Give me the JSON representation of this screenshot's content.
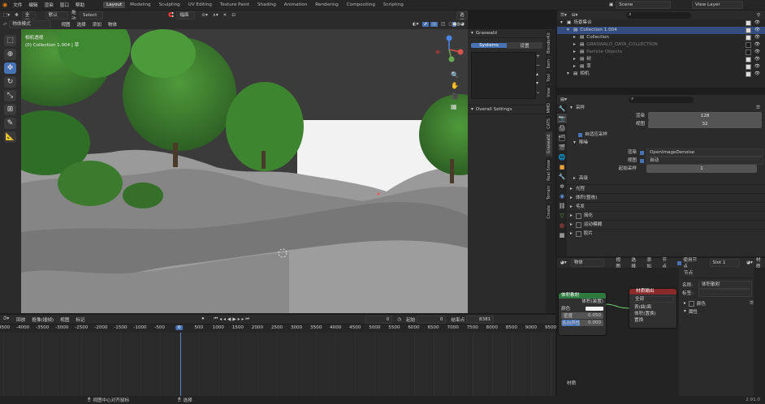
{
  "topbar": {
    "menus": [
      "文件",
      "编辑",
      "渲染",
      "窗口",
      "帮助"
    ],
    "workspaces": [
      "Layout",
      "Modeling",
      "Sculpting",
      "UV Editing",
      "Texture Paint",
      "Shading",
      "Animation",
      "Rendering",
      "Compositing",
      "Scripting"
    ],
    "active_workspace": "Layout",
    "scene": "Scene",
    "view_layer": "View Layer"
  },
  "viewport": {
    "orientation_label": "全局系",
    "pivot_label": "默认",
    "drag_label": "拖动",
    "select_mode": "Select Box",
    "snap_label": "幅面",
    "options_label": "选项",
    "mode": "物体模式",
    "menu": [
      "视图",
      "选择",
      "添加",
      "物体"
    ],
    "overlay_title": "相机透视",
    "overlay_subtitle": "(0) Collection 1.004 | 草",
    "colors": {
      "sky": "#f2f2f2",
      "ground": "#6e6e6e",
      "tree": "#3d7a2e"
    }
  },
  "npanel": {
    "title": "Graswald",
    "tab_systems": "Systems",
    "tab_settings": "设置",
    "section": "Overall Settings",
    "side_tabs": [
      "BlenderKit",
      "Item",
      "Tool",
      "View",
      "MMD",
      "CATS",
      "Graswald",
      "Real Snow",
      "Terrain",
      "Create"
    ]
  },
  "timeline": {
    "menu": [
      "回放",
      "抠像(插帧)",
      "视图",
      "标记"
    ],
    "current_frame": "0",
    "start_label": "起始",
    "start": "0",
    "end_label": "结束点",
    "end": "8381",
    "ruler": [
      "-4500",
      "-4000",
      "-3500",
      "-3000",
      "-2500",
      "-2000",
      "-1500",
      "-1000",
      "-500",
      "0",
      "500",
      "1000",
      "1500",
      "2000",
      "2500",
      "3000",
      "3500",
      "4000",
      "4500",
      "5000",
      "5500",
      "6000",
      "6500",
      "7000",
      "7500",
      "8000",
      "8500",
      "9000",
      "9500"
    ]
  },
  "outliner": {
    "rows": [
      {
        "label": "场景集合",
        "indent": 0
      },
      {
        "label": "Collection 1.004",
        "indent": 1,
        "selected": true
      },
      {
        "label": "Collection",
        "indent": 2
      },
      {
        "label": "GRASWALD_DATA_COLLECTION",
        "indent": 2,
        "dim": true
      },
      {
        "label": "Particle Objects",
        "indent": 2,
        "dim": true
      },
      {
        "label": "树",
        "indent": 2
      },
      {
        "label": "草",
        "indent": 2
      },
      {
        "label": "相机",
        "indent": 1
      }
    ]
  },
  "properties": {
    "section_sampling": "采样",
    "render_label": "渲染",
    "render_value": "128",
    "viewport_label": "视图",
    "viewport_value": "32",
    "adaptive": "自适应采样",
    "denoise": "降噪",
    "denoise_render_label": "渲染",
    "denoiser": "OpenImageDenoise",
    "denoise_viewport_label": "视图",
    "denoise_viewport_value": "自动",
    "start_sample_label": "起始采样",
    "start_sample_value": "1",
    "advanced": "高级",
    "sections": [
      "光程",
      "体积(整栋)",
      "毛发",
      "简化",
      "运动模糊",
      "胶片"
    ]
  },
  "node_editor": {
    "type": "物体",
    "menu": [
      "视图",
      "选择",
      "添加",
      "节点"
    ],
    "use_nodes": "使用节点",
    "slot": "Slot 1",
    "material_short": "材质",
    "node_rgb_title": "体积散射",
    "node_rgb_output": "体积(装置)",
    "color_label": "颜色",
    "density_label": "密度",
    "density_value": "0.050",
    "anisotropy_label": "各向异性",
    "anisotropy_value": "0.000",
    "output_title": "材质输出",
    "output_target": "全部",
    "output_surface": "表(曲)面",
    "output_volume": "体积(置换)",
    "output_disp": "置换",
    "area_label": "材质",
    "side_title": "节点",
    "side_name_label": "名称:",
    "side_name_value": "体积散射",
    "side_label_label": "标签:",
    "side_color": "颜色",
    "side_props": "属性"
  },
  "statusbar": {
    "hint1": "视图中心对齐鼠标",
    "hint2": "选择",
    "version": "2.91.0"
  }
}
